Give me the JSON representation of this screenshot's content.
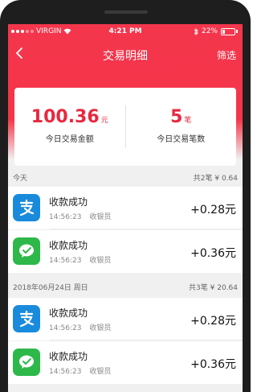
{
  "status": {
    "carrier": "VIRGIN",
    "time": "4:21 PM",
    "battery": "22%"
  },
  "nav": {
    "title": "交易明细",
    "filter": "筛选"
  },
  "summary": {
    "amount_value": "100.36",
    "amount_unit": "元",
    "amount_label": "今日交易金额",
    "count_value": "5",
    "count_unit": "笔",
    "count_label": "今日交易笔数"
  },
  "groups": [
    {
      "date": "今天",
      "stats": "共2笔  ¥ 0.64",
      "items": [
        {
          "icon": "alipay-icon",
          "title": "收款成功",
          "time": "14:56:23",
          "operator": "收银员",
          "amount": "+0.28元"
        },
        {
          "icon": "wechat-pay-icon",
          "title": "收款成功",
          "time": "14:56:23",
          "operator": "收银员",
          "amount": "+0.36元"
        }
      ]
    },
    {
      "date": "2018年06月24日  周日",
      "stats": "共3笔  ¥ 20.64",
      "items": [
        {
          "icon": "alipay-icon",
          "title": "收款成功",
          "time": "14:56:23",
          "operator": "收银员",
          "amount": "+0.28元"
        },
        {
          "icon": "wechat-pay-icon",
          "title": "收款成功",
          "time": "14:56:23",
          "operator": "收银员",
          "amount": "+0.36元"
        }
      ]
    }
  ],
  "colors": {
    "accent": "#f4364c",
    "amount_red": "#e8283f",
    "alipay_blue": "#1a8bdc",
    "wechat_green": "#2eb84a"
  }
}
